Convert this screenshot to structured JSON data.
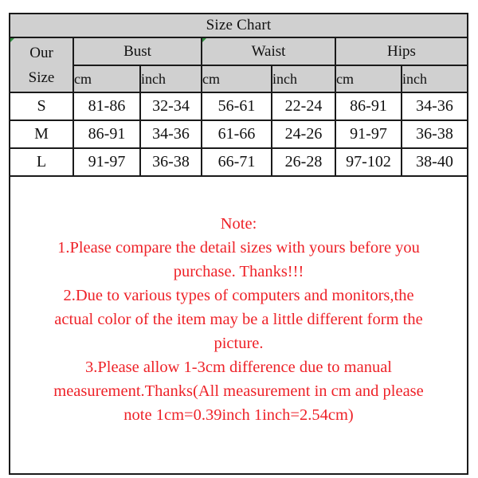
{
  "title": "Size Chart",
  "table": {
    "size_column_header": "Our Size",
    "size_column_header_line1": "Our",
    "size_column_header_line2": "Size",
    "measurement_groups": [
      "Bust",
      "Waist",
      "Hips"
    ],
    "units": [
      "cm",
      "inch",
      "cm",
      "inch",
      "cm",
      "inch"
    ],
    "rows": [
      {
        "size": "S",
        "bust_cm": "81-86",
        "bust_inch": "32-34",
        "waist_cm": "56-61",
        "waist_inch": "22-24",
        "hips_cm": "86-91",
        "hips_inch": "34-36"
      },
      {
        "size": "M",
        "bust_cm": "86-91",
        "bust_inch": "34-36",
        "waist_cm": "61-66",
        "waist_inch": "24-26",
        "hips_cm": "91-97",
        "hips_inch": "36-38"
      },
      {
        "size": "L",
        "bust_cm": "91-97",
        "bust_inch": "36-38",
        "waist_cm": "66-71",
        "waist_inch": "26-28",
        "hips_cm": "97-102",
        "hips_inch": "38-40"
      }
    ]
  },
  "note": {
    "heading": "Note:",
    "lines": [
      "1.Please compare the detail sizes with yours before you",
      "purchase. Thanks!!!",
      "2.Due to various types of computers and monitors,the",
      "actual color of the item may be a little different form the",
      "picture.",
      "3.Please allow 1-3cm difference due to manual",
      "measurement.Thanks(All measurement in cm and please",
      "note 1cm=0.39inch 1inch=2.54cm)"
    ]
  },
  "colors": {
    "header_background": "#d0d0d0",
    "border": "#1a1a1a",
    "note_text": "#ee2228",
    "body_text": "#111111",
    "artifact_green": "#2f8f3e"
  }
}
